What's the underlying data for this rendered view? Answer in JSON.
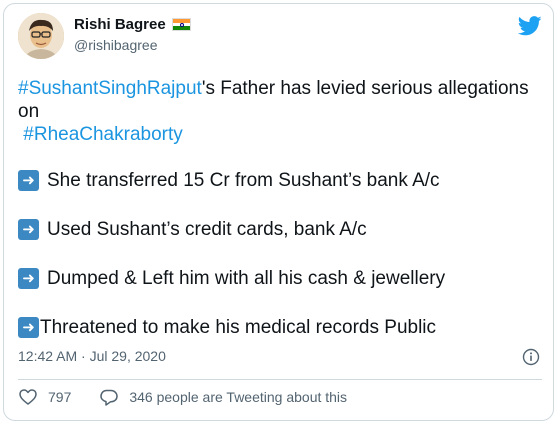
{
  "author": {
    "name": "Rishi Bagree",
    "handle": "@rishibagree",
    "flag_icon": "india-flag-icon"
  },
  "tweet": {
    "line1_hashtag": "#SushantSinghRajput",
    "line1_text": "'s Father has levied serious allegations",
    "line2_text": "on",
    "line3_hashtag": "#RheaChakraborty",
    "bullets": [
      "She transferred 15 Cr from Sushant’s bank A/c",
      "Used Sushant’s credit cards, bank A/c",
      "Dumped & Left him with all his cash & jewellery",
      "Threatened to make his medical records Public"
    ],
    "bullet_icon": "arrow-right-emoji-icon",
    "timestamp": "12:42 AM · Jul 29, 2020"
  },
  "actions": {
    "likes": "797",
    "conversation": "346 people are Tweeting about this"
  },
  "colors": {
    "hashtag": "#1b95e0",
    "twitter_blue": "#1da1f2",
    "secondary_text": "#536471",
    "border": "#cfd9de",
    "arrow_emoji_bg": "#3b88c3"
  }
}
